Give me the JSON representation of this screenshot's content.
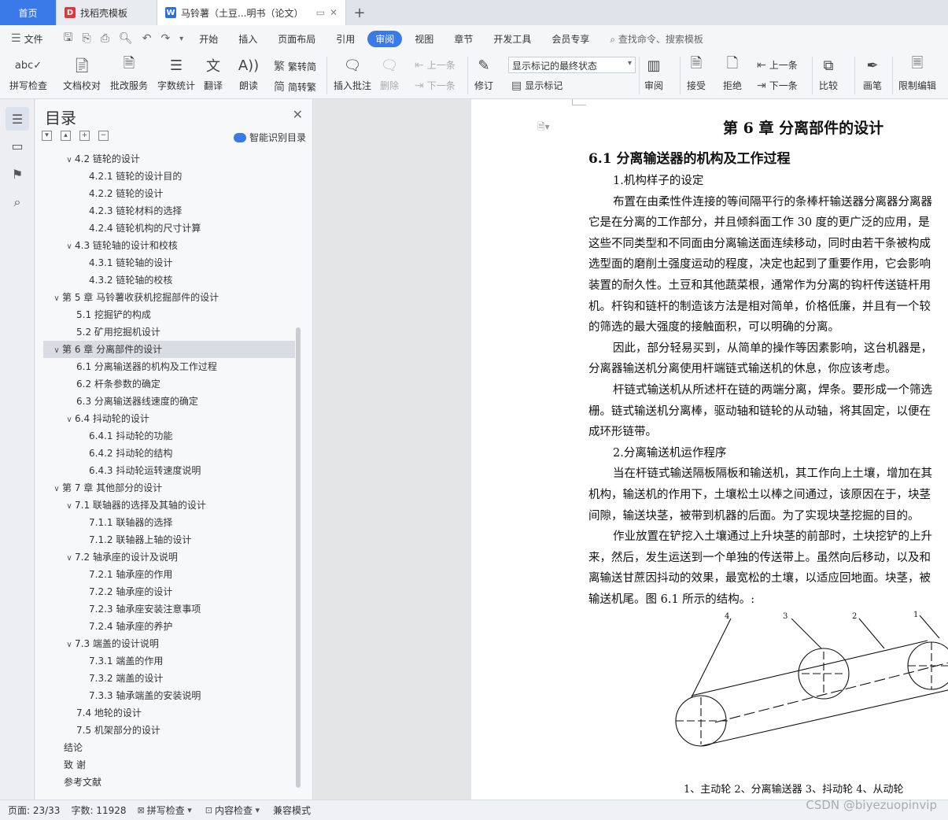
{
  "tabs": {
    "home": "首页",
    "template": "找稻壳模板",
    "doc": "马铃薯（土豆...明书（论文）",
    "add": "+"
  },
  "menu": {
    "file": "文件",
    "items": [
      "开始",
      "插入",
      "页面布局",
      "引用",
      "审阅",
      "视图",
      "章节",
      "开发工具",
      "会员专享"
    ],
    "active": "审阅",
    "search": "查找命令、搜索模板"
  },
  "ribbon": {
    "spell": "拼写检查",
    "proof": "文档校对",
    "batch": "批改服务",
    "wordcount": "字数统计",
    "translate": "翻译",
    "read": "朗读",
    "trad": "繁转简",
    "simp": "简转繁",
    "insert_comment": "插入批注",
    "delete": "删除",
    "prev": "上一条",
    "next": "下一条",
    "revise": "修订",
    "markup_state": "显示标记的最终状态",
    "show_markup": "显示标记",
    "review": "审阅",
    "accept": "接受",
    "reject": "拒绝",
    "prev2": "上一条",
    "next2": "下一条",
    "compare": "比较",
    "pen": "画笔",
    "restrict": "限制编辑"
  },
  "toc": {
    "title": "目录",
    "smart": "智能识别目录",
    "items": [
      {
        "level": 1,
        "caret": "down",
        "text": "4.2  链轮的设计"
      },
      {
        "level": 2,
        "caret": "",
        "text": "4.2.1  链轮的设计目的"
      },
      {
        "level": 2,
        "caret": "",
        "text": "4.2.2  链轮的设计"
      },
      {
        "level": 2,
        "caret": "",
        "text": "4.2.3  链轮材料的选择"
      },
      {
        "level": 2,
        "caret": "",
        "text": "4.2.4  链轮机构的尺寸计算"
      },
      {
        "level": 1,
        "caret": "down",
        "text": "4.3 链轮轴的设计和校核"
      },
      {
        "level": 2,
        "caret": "",
        "text": "4.3.1  链轮轴的设计"
      },
      {
        "level": 2,
        "caret": "",
        "text": "4.3.2  链轮轴的校核"
      },
      {
        "level": 0,
        "caret": "down",
        "text": "第 5 章  马铃薯收获机挖掘部件的设计"
      },
      {
        "level": 1,
        "caret": "",
        "text": "5.1  挖掘铲的构成"
      },
      {
        "level": 1,
        "caret": "",
        "text": "5.2  矿用挖掘机设计"
      },
      {
        "level": 0,
        "caret": "down",
        "text": "第 6 章  分离部件的设计",
        "selected": true
      },
      {
        "level": 1,
        "caret": "",
        "text": "6.1  分离输送器的机构及工作过程"
      },
      {
        "level": 1,
        "caret": "",
        "text": "6.2  杆条参数的确定"
      },
      {
        "level": 1,
        "caret": "",
        "text": "6.3  分离输送器线速度的确定"
      },
      {
        "level": 1,
        "caret": "down",
        "text": "6.4  抖动轮的设计"
      },
      {
        "level": 2,
        "caret": "",
        "text": "6.4.1  抖动轮的功能"
      },
      {
        "level": 2,
        "caret": "",
        "text": "6.4.2  抖动轮的结构"
      },
      {
        "level": 2,
        "caret": "",
        "text": "6.4.3  抖动轮运转速度说明"
      },
      {
        "level": 0,
        "caret": "down",
        "text": "第 7 章  其他部分的设计"
      },
      {
        "level": 1,
        "caret": "down",
        "text": "7.1 联轴器的选择及其轴的设计"
      },
      {
        "level": 2,
        "caret": "",
        "text": "7.1.1  联轴器的选择"
      },
      {
        "level": 2,
        "caret": "",
        "text": "7.1.2  联轴器上轴的设计"
      },
      {
        "level": 1,
        "caret": "down",
        "text": "7.2  轴承座的设计及说明"
      },
      {
        "level": 2,
        "caret": "",
        "text": "7.2.1 轴承座的作用"
      },
      {
        "level": 2,
        "caret": "",
        "text": "7.2.2  轴承座的设计"
      },
      {
        "level": 2,
        "caret": "",
        "text": "7.2.3  轴承座安装注意事项"
      },
      {
        "level": 2,
        "caret": "",
        "text": "7.2.4  轴承座的养护"
      },
      {
        "level": 1,
        "caret": "down",
        "text": "7.3  端盖的设计说明"
      },
      {
        "level": 2,
        "caret": "",
        "text": "7.3.1  端盖的作用"
      },
      {
        "level": 2,
        "caret": "",
        "text": "7.3.2  端盖的设计"
      },
      {
        "level": 2,
        "caret": "",
        "text": "7.3.3  轴承端盖的安装说明"
      },
      {
        "level": 1,
        "caret": "",
        "text": "7.4  地轮的设计"
      },
      {
        "level": 1,
        "caret": "",
        "text": "7.5  机架部分的设计"
      },
      {
        "level": 0,
        "caret": "",
        "text": "结论"
      },
      {
        "level": 0,
        "caret": "",
        "text": "致    谢"
      },
      {
        "level": 0,
        "caret": "",
        "text": "参考文献"
      }
    ]
  },
  "doc": {
    "chapter": "第 6 章  分离部件的设计",
    "section": "6.1  分离输送器的机构及工作过程",
    "lines": [
      {
        "indent": true,
        "text": "1.机构样子的设定"
      },
      {
        "indent": true,
        "text": "布置在由柔性件连接的等间隔平行的条棒杆输送器分离器分离器"
      },
      {
        "indent": false,
        "text": "它是在分离的工作部分，并且倾斜面工作 30 度的更广泛的应用，是"
      },
      {
        "indent": false,
        "text": "这些不同类型和不同面由分离输送面连续移动，同时由若干条被构成"
      },
      {
        "indent": false,
        "text": "选型面的磨削土强度运动的程度，决定也起到了重要作用，它会影响"
      },
      {
        "indent": false,
        "text": "装置的耐久性。土豆和其他蔬菜根，通常作为分离的钩杆传送链杆用"
      },
      {
        "indent": false,
        "text": "机。杆钩和链杆的制造该方法是相对简单，价格低廉，并且有一个较"
      },
      {
        "indent": false,
        "text": "的筛选的最大强度的接触面积，可以明确的分离。"
      },
      {
        "indent": true,
        "text": "因此，部分轻易买到，从简单的操作等因素影响，这台机器是，"
      },
      {
        "indent": false,
        "text": "分离器输送机分离使用杆端链式输送机的休息，你应该考虑。"
      },
      {
        "indent": true,
        "text": "杆链式输送机从所述杆在链的两端分离，焊条。要形成一个筛选"
      },
      {
        "indent": false,
        "text": "栅。链式输送机分离棒，驱动轴和链轮的从动轴，将其固定，以便在"
      },
      {
        "indent": false,
        "text": "成环形链带。"
      },
      {
        "indent": true,
        "text": "2.分离输送机运作程序"
      },
      {
        "indent": true,
        "text": "当在杆链式输送隔板隔板和输送机，其工作向上土壤，增加在其"
      },
      {
        "indent": false,
        "text": "机构，输送机的作用下，土壤松土以棒之间通过，该原因在于，块茎"
      },
      {
        "indent": false,
        "text": "间隙，输送块茎，被带到机器的后面。为了实现块茎挖掘的目的。"
      },
      {
        "indent": true,
        "text": "作业放置在铲挖入土壤通过上升块茎的前部时，土块挖铲的上升"
      },
      {
        "indent": false,
        "text": "来，然后，发生运送到一个单独的传送带上。虽然向后移动，以及和"
      },
      {
        "indent": false,
        "text": "离输送甘蔗因抖动的效果，最宽松的土壤，以适应回地面。块茎，被"
      },
      {
        "indent": false,
        "text": "输送机尾。图 6.1 所示的结构。:"
      }
    ],
    "figure_labels": [
      "4",
      "3",
      "2",
      "1"
    ],
    "caption": "1、主动轮   2、分离输送器   3、抖动轮   4、从动轮"
  },
  "status": {
    "page": "页面: 23/33",
    "words": "字数: 11928",
    "spell": "拼写检查",
    "content": "内容检查",
    "mode": "兼容模式",
    "watermark": "CSDN @biyezuopinvip"
  },
  "colors": {
    "accent": "#3a79e8",
    "tab_doc_icon": "#2a6ee8",
    "tab_tpl_icon": "#e0373b"
  }
}
